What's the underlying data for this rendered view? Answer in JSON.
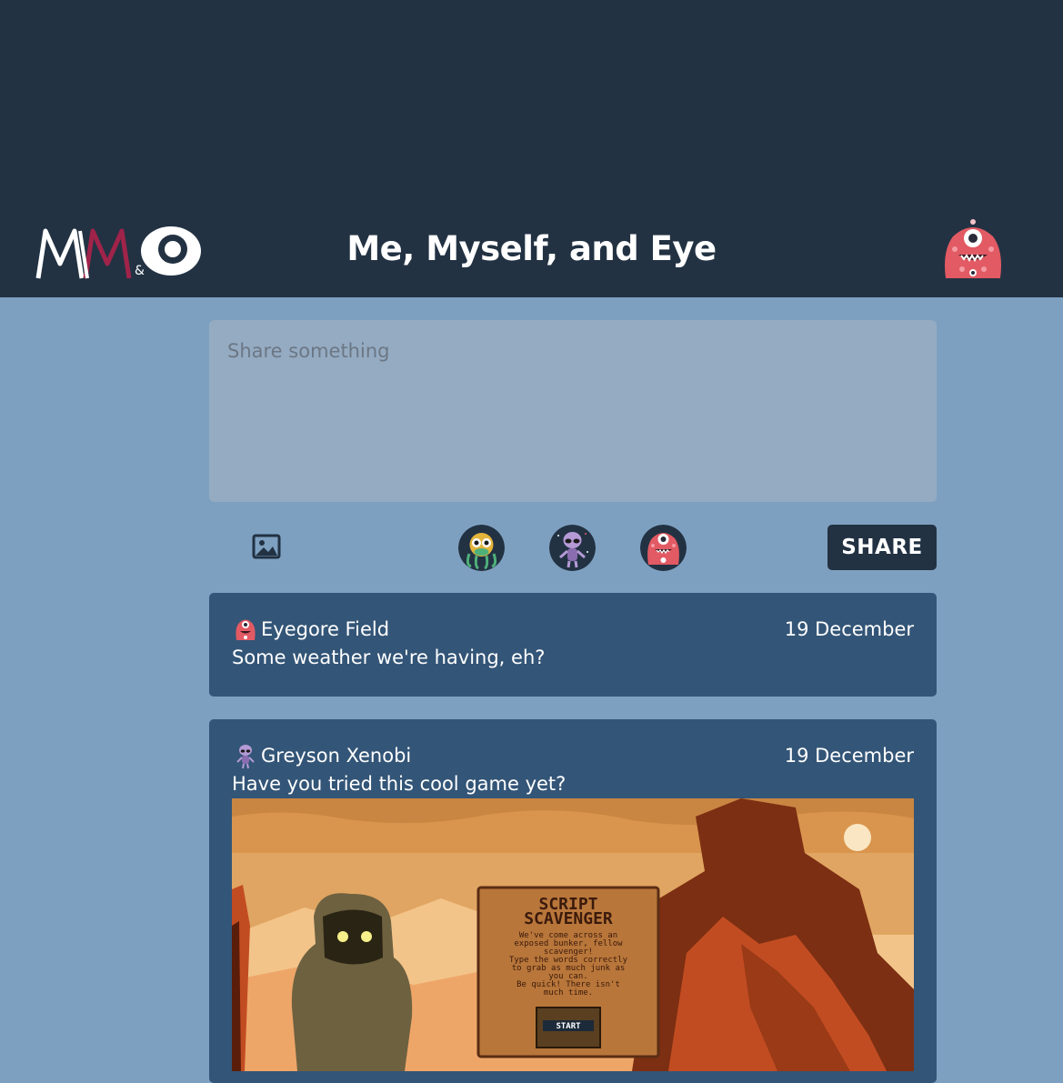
{
  "header": {
    "title": "Me, Myself, and Eye",
    "logo_icon": "mm-eye-logo-icon",
    "profile_avatar_icon": "red-cyclops-monster-icon"
  },
  "composer": {
    "placeholder": "Share something",
    "image_button_icon": "image-icon",
    "avatar_choices": [
      "green-octopus-monster-icon",
      "purple-alien-icon",
      "red-cyclops-monster-icon"
    ],
    "share_label": "SHARE"
  },
  "posts": [
    {
      "author": "Eyegore Field",
      "date": "19 December",
      "text": "Some weather we're having, eh?",
      "avatar_icon": "red-cyclops-monster-icon"
    },
    {
      "author": "Greyson Xenobi",
      "date": "19 December",
      "text": "Have you tried this cool game yet?",
      "avatar_icon": "purple-alien-icon",
      "image": {
        "title_line1": "SCRIPT",
        "title_line2": "SCAVENGER",
        "desc": [
          "We've come across an",
          "exposed bunker, fellow",
          "scavenger!",
          "Type the words correctly",
          "to grab as much junk as",
          "you can.",
          "Be quick! There isn't",
          "much time."
        ],
        "start_label": "START"
      }
    }
  ],
  "colors": {
    "header_bg": "#223243",
    "page_bg": "#7ea0c0",
    "post_bg": "#335577",
    "compose_bg": "#95abc2",
    "accent": "#a0234a"
  }
}
